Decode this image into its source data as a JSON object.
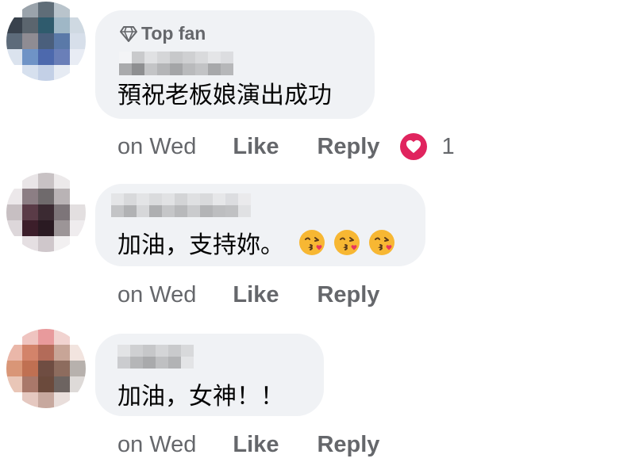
{
  "comments": [
    {
      "badge": "Top fan",
      "text": "預祝老板娘演出成功",
      "emojis": [],
      "timestamp": "on Wed",
      "like_label": "Like",
      "reply_label": "Reply",
      "reaction": {
        "icon": "heart-reaction-icon",
        "count": "1"
      }
    },
    {
      "text": "加油，支持妳。",
      "emojis": [
        "kissing-face-icon",
        "kissing-face-icon",
        "kissing-face-icon"
      ],
      "timestamp": "on Wed",
      "like_label": "Like",
      "reply_label": "Reply"
    },
    {
      "text": "加油，女神！！",
      "emojis": [],
      "timestamp": "on Wed",
      "like_label": "Like",
      "reply_label": "Reply"
    }
  ],
  "colors": {
    "bubble": "#f0f2f5",
    "secondary_text": "#65676b",
    "primary_text": "#050505",
    "reaction_heart": "#e0245e"
  }
}
